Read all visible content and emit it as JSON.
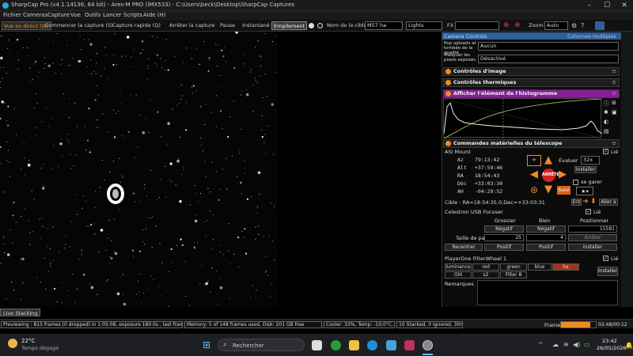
{
  "window": {
    "title": "SharpCap Pro (v4.1.14136, 64 bit) - Ares-M PRO (IMX533) - C:\\Users\\beck\\Desktop\\SharpCap Captures"
  },
  "menu": [
    "Fichier",
    "Cameras",
    "Capture",
    "Vue",
    "Outils",
    "Lancer",
    "Scripts",
    "Aide (H)"
  ],
  "toolbar": {
    "live": "Vue en direct (W)",
    "start": "Commencer la capture (S)",
    "quick": "Capture rapide (Q)",
    "stop": "Arrêter la capture",
    "pause": "Pause",
    "snapshot": "Instantané",
    "stack": "Empilement",
    "target_label": "Nom de la cible:",
    "target_value": "M57 ha",
    "frame_type": "Lights",
    "fx_label": "FX",
    "zoom_label": "Zoom",
    "zoom_value": "Auto"
  },
  "panel": {
    "camera_controls": "Camera Controls",
    "multiple_columns": "Colonnes multiples",
    "dropped_label": "Pop uploads at tombée de la qualité",
    "dropped_value": "Aucun",
    "hot_pixels_label": "Masquer les pixels exposés",
    "hot_pixels_value": "Désactivé",
    "image_controls": "Contrôles d'image",
    "thermal_controls": "Contrôles thermiques",
    "histogram": "Afficher l'élément de l'histogramme",
    "hardware": "Commandes matérielles du télescope",
    "mount": {
      "name": "ASI Mount",
      "link": "Lié",
      "rows": [
        [
          "Az",
          "79:13:42"
        ],
        [
          "Alt",
          "+37:59:46"
        ],
        [
          "RA",
          "18:54:43"
        ],
        [
          "Déc",
          "+33:03:30"
        ],
        [
          "AH",
          "-04:29:52"
        ]
      ],
      "rate_label": "Évaluer",
      "rate_value": "32x",
      "install": "Installer",
      "park": "se garer",
      "stop": "ARRÊTE",
      "follow": "Suivi",
      "target": "Cible : RA=18:54:35.0,Dec=+33:03:31",
      "enter": "Ent",
      "goto": "Aller à"
    },
    "focuser": {
      "name": "Celestron USB Focuser",
      "link": "Lié",
      "coarse": "Grossier",
      "fine": "Bien",
      "position": "Positionner",
      "neg": "Négatif",
      "pos": "Positif",
      "position_value": "15581",
      "step_label": "Taille de pas",
      "coarse_step": "25",
      "fine_step": "4",
      "stop": "Arrêter",
      "back": "Recentrer",
      "install": "Installer"
    },
    "filterwheel": {
      "name": "PlayerOne FilterWheel 1",
      "link": "Lié",
      "filters": [
        "luminance",
        "red",
        "green",
        "blue",
        "ha",
        "OIII",
        "s2",
        "Filter 8"
      ],
      "install": "Installer"
    },
    "notes": "Remarques"
  },
  "status": {
    "preview": "Previewing : 815 frames (0 dropped) in 1:05:08, exposure 180.0s , last frame 180.0s",
    "memory": "Memory: 5 of 148 frames used, Disk: 201 GB free",
    "cooler": "Cooler: 33%, Temp: -10,0°C, Target: -10,0°",
    "stack": "10 Stacked, 0 Ignored, 30m 0s",
    "frame_label": "Frame:",
    "frame_time": "02:48/00:12",
    "frame_progress": 0.85
  },
  "live_stacking_tab": "Live Stacking",
  "taskbar": {
    "weather_temp": "22°C",
    "weather_desc": "Temps dégagé",
    "search": "Rechercher",
    "time": "23:42",
    "date": "26/05/2026"
  },
  "colors": {
    "accent": "#f08a24",
    "histogram_header": "#8a1c9c",
    "filter_active": "#a0341c"
  }
}
